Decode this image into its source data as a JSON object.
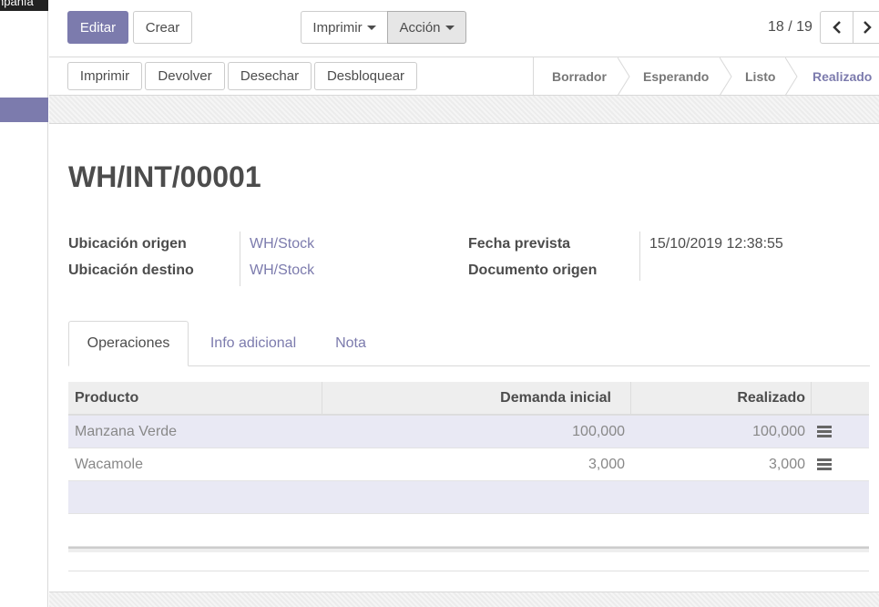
{
  "sidebar": {
    "top_text": "npañía"
  },
  "control_panel": {
    "edit_label": "Editar",
    "create_label": "Crear",
    "print_label": "Imprimir",
    "action_label": "Acción",
    "pager_value": "18 / 19"
  },
  "statusbar": {
    "buttons": [
      "Imprimir",
      "Devolver",
      "Desechar",
      "Desbloquear"
    ],
    "stages": [
      "Borrador",
      "Esperando",
      "Listo",
      "Realizado"
    ],
    "active_stage": "Realizado"
  },
  "record": {
    "title": "WH/INT/00001",
    "source_location_label": "Ubicación origen",
    "source_location": "WH/Stock",
    "dest_location_label": "Ubicación destino",
    "dest_location": "WH/Stock",
    "scheduled_date_label": "Fecha prevista",
    "scheduled_date": "15/10/2019 12:38:55",
    "origin_label": "Documento origen",
    "origin": ""
  },
  "tabs": [
    "Operaciones",
    "Info adicional",
    "Nota"
  ],
  "table": {
    "headers": [
      "Producto",
      "Demanda inicial",
      "Realizado"
    ],
    "rows": [
      {
        "product": "Manzana Verde",
        "demand": "100,000",
        "done": "100,000"
      },
      {
        "product": "Wacamole",
        "demand": "3,000",
        "done": "3,000"
      }
    ]
  },
  "colors": {
    "brand": "#7c7bad",
    "text": "#4c4c4c"
  }
}
